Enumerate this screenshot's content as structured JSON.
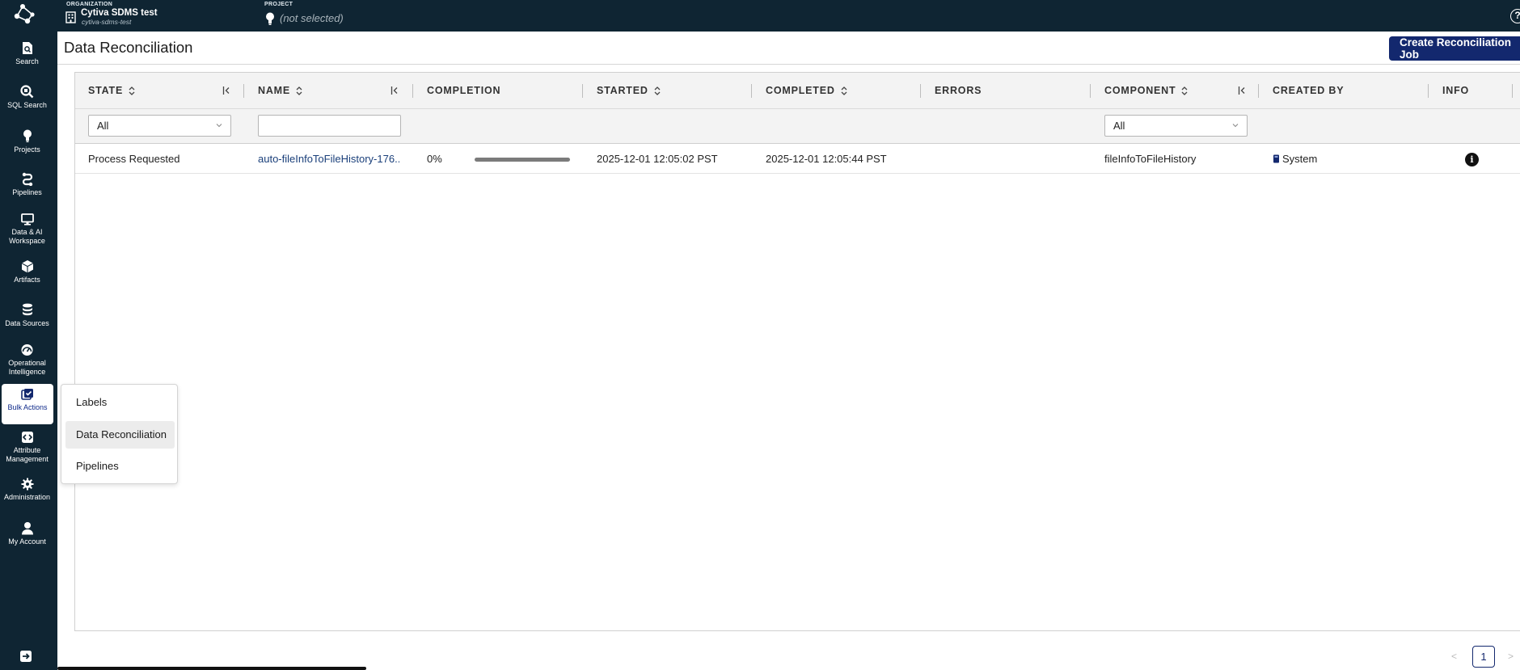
{
  "topbar": {
    "org_label": "ORGANIZATION",
    "org_name": "Cytiva SDMS test",
    "org_sub": "cytiva-sdms-test",
    "project_label": "PROJECT",
    "project_value": "(not selected)",
    "help_glyph": "?"
  },
  "sidebar": {
    "items": [
      {
        "label": "Search",
        "icon": "search-doc-icon"
      },
      {
        "label": "SQL Search",
        "icon": "sql-search-icon"
      },
      {
        "label": "Projects",
        "icon": "lightbulb-icon"
      },
      {
        "label": "Pipelines",
        "icon": "pipeline-icon"
      },
      {
        "label": "Data & AI Workspace",
        "icon": "monitor-icon"
      },
      {
        "label": "Artifacts",
        "icon": "cube-icon"
      },
      {
        "label": "Data Sources",
        "icon": "database-icon"
      },
      {
        "label": "Operational Intelligence",
        "icon": "gauge-icon"
      },
      {
        "label": "Bulk Actions",
        "icon": "bulk-check-icon"
      },
      {
        "label": "Attribute Management",
        "icon": "code-brackets-icon"
      },
      {
        "label": "Administration",
        "icon": "gear-icon"
      },
      {
        "label": "My Account",
        "icon": "user-icon"
      }
    ]
  },
  "page": {
    "title": "Data Reconciliation",
    "create_button": "Create Reconciliation Job"
  },
  "table": {
    "columns": [
      "STATE",
      "NAME",
      "COMPLETION",
      "STARTED",
      "COMPLETED",
      "ERRORS",
      "COMPONENT",
      "CREATED BY",
      "INFO"
    ],
    "filters": {
      "state": "All",
      "name": "",
      "component": "All"
    },
    "rows": [
      {
        "state": "Process Requested",
        "name": "auto-fileInfoToFileHistory-176...",
        "completion_text": "0%",
        "completion_value": 0.0,
        "started": "2025-12-01 12:05:02 PST",
        "completed": "2025-12-01 12:05:44 PST",
        "errors": "",
        "component": "fileInfoToFileHistory",
        "created_by": "System",
        "info_glyph": "i"
      }
    ]
  },
  "pagination": {
    "prev": "<",
    "current": "1",
    "next": ">"
  },
  "menu": {
    "items": [
      "Labels",
      "Data Reconciliation",
      "Pipelines"
    ]
  }
}
